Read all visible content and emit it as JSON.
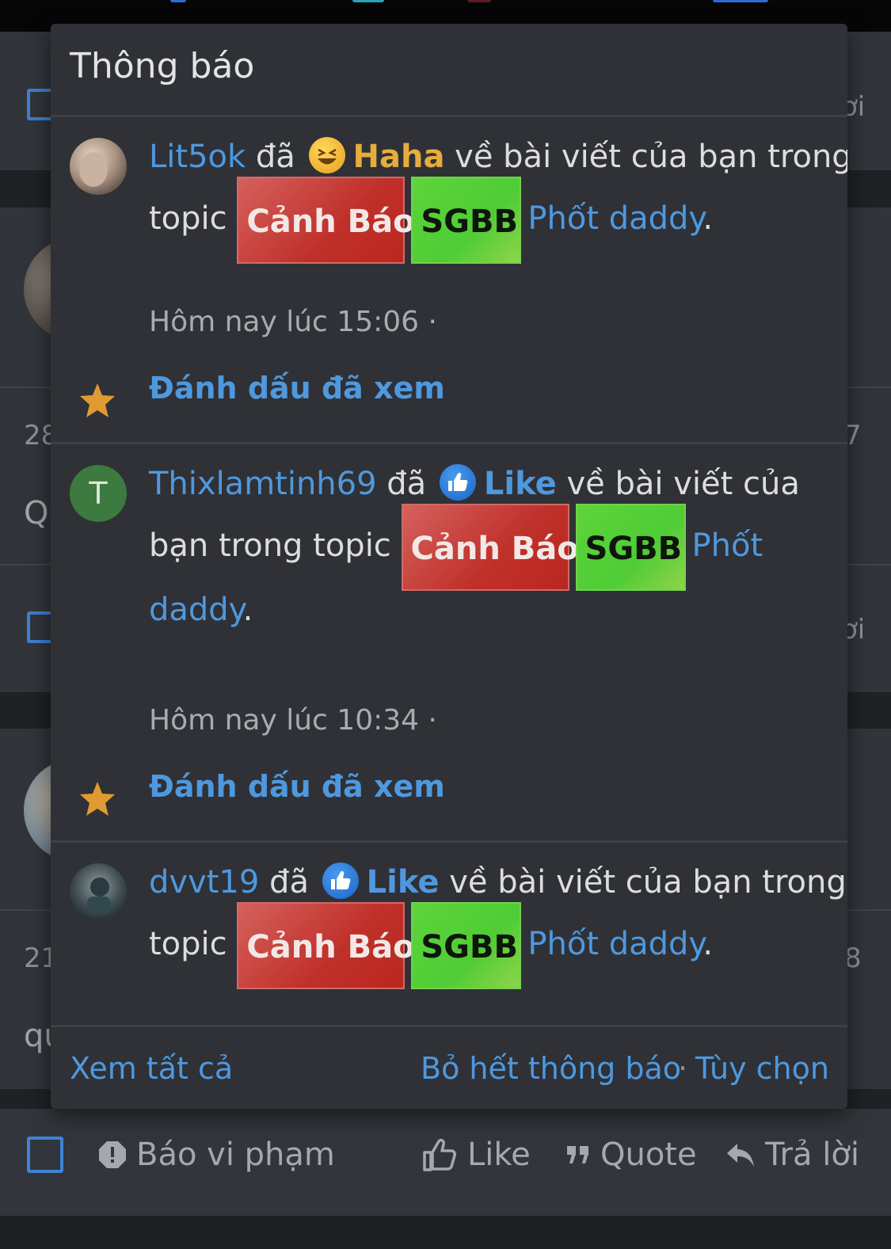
{
  "popup": {
    "title": "Thông báo",
    "notifications": [
      {
        "user": "Lit5ok",
        "verb": "đã",
        "reaction_icon": "haha-emoji-icon",
        "reaction": "Haha",
        "text_a": "về bài viết của bạn trong",
        "text_b": "topic",
        "badge_1": "Cảnh Báo",
        "badge_2": "SGBB",
        "topic": "Phốt daddy",
        "period": ".",
        "time": "Hôm nay lúc 15:06 ·",
        "mark_read": "Đánh dấu đã xem"
      },
      {
        "user": "Thixlamtinh69",
        "avatar_letter": "T",
        "verb": "đã",
        "reaction_icon": "like-emoji-icon",
        "reaction": "Like",
        "text_a": "về bài viết của",
        "text_b": "bạn trong topic",
        "badge_1": "Cảnh Báo",
        "badge_2": "SGBB",
        "topic_a": "Phốt",
        "topic_b": "daddy",
        "period": ".",
        "time": "Hôm nay lúc 10:34 ·",
        "mark_read": "Đánh dấu đã xem"
      },
      {
        "user": "dvvt19",
        "verb": "đã",
        "reaction_icon": "like-emoji-icon",
        "reaction": "Like",
        "text_a": "về bài viết của bạn trong",
        "text_b": "topic",
        "badge_1": "Cảnh Báo",
        "badge_2": "SGBB",
        "topic": "Phốt daddy",
        "period": "."
      }
    ],
    "footer": {
      "view_all": "Xem tất cả",
      "unfollow_all": "Bỏ hết thông báo",
      "separator": "·",
      "options": "Tùy chọn"
    }
  },
  "background": {
    "fragments": [
      "ơi",
      "28",
      "7",
      "Q",
      "ơi",
      "21",
      "8",
      "qu"
    ]
  },
  "action_bar": {
    "report": "Báo vi phạm",
    "like": "Like",
    "quote": "Quote",
    "reply": "Trả lời"
  },
  "colors": {
    "link": "#4f98de",
    "haha": "#e6ac3c",
    "warn_badge": "#c0302a",
    "sgbb_badge": "#4fcc36",
    "popup_bg": "#2f3136"
  }
}
